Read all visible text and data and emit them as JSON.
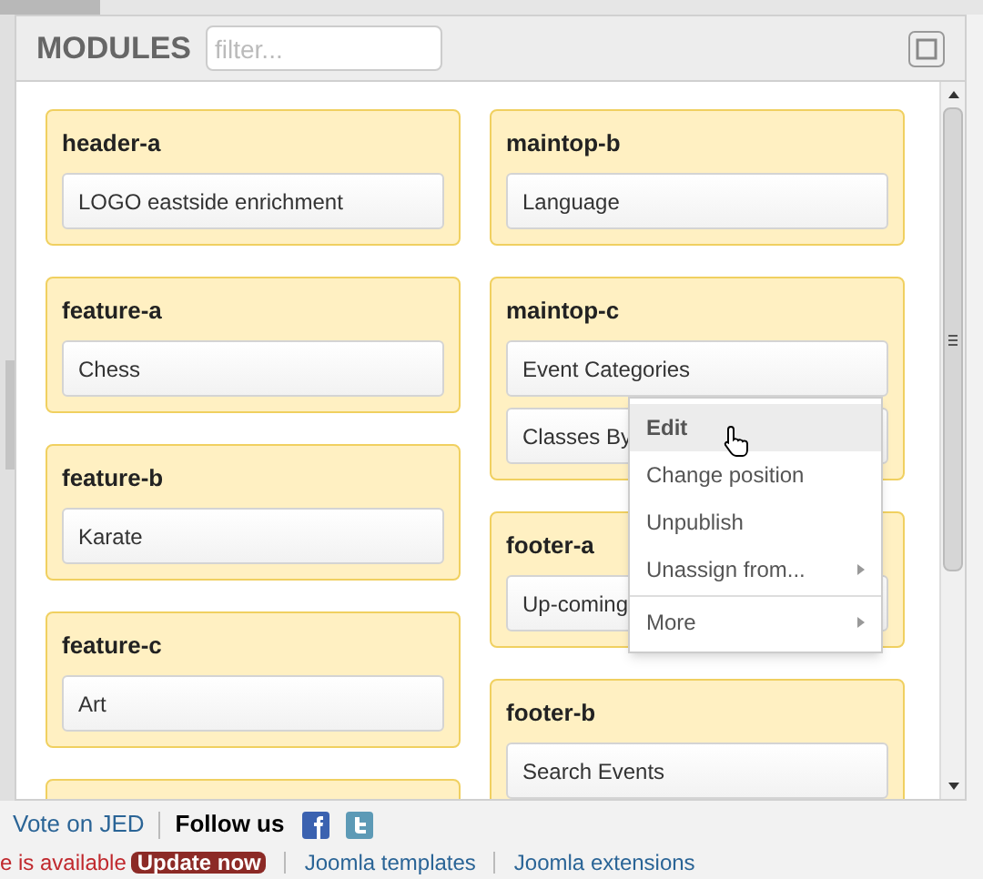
{
  "panel": {
    "title": "MODULES",
    "filter": {
      "placeholder": "filter..."
    }
  },
  "columns": [
    [
      {
        "position": "header-a",
        "modules": [
          "LOGO eastside enrichment"
        ]
      },
      {
        "position": "feature-a",
        "modules": [
          "Chess"
        ]
      },
      {
        "position": "feature-b",
        "modules": [
          "Karate"
        ]
      },
      {
        "position": "feature-c",
        "modules": [
          "Art"
        ]
      }
    ],
    [
      {
        "position": "maintop-b",
        "modules": [
          "Language"
        ]
      },
      {
        "position": "maintop-c",
        "modules": [
          "Event Categories",
          "Classes By"
        ]
      },
      {
        "position": "footer-a",
        "modules": [
          "Up-coming"
        ]
      },
      {
        "position": "footer-b",
        "modules": [
          "Search Events"
        ]
      }
    ]
  ],
  "context_menu": [
    {
      "label": "Edit",
      "selected": true,
      "submenu": false
    },
    {
      "label": "Change position",
      "selected": false,
      "submenu": false
    },
    {
      "label": "Unpublish",
      "selected": false,
      "submenu": false
    },
    {
      "label": "Unassign from...",
      "selected": false,
      "submenu": true
    },
    {
      "label": "More",
      "selected": false,
      "submenu": true,
      "divider_before": true
    }
  ],
  "footer": {
    "vote_link": "Vote on JED",
    "follow_label": "Follow us"
  },
  "notice": {
    "message": "e is available",
    "button": "Update now",
    "links": [
      "Joomla templates",
      "Joomla extensions"
    ]
  }
}
